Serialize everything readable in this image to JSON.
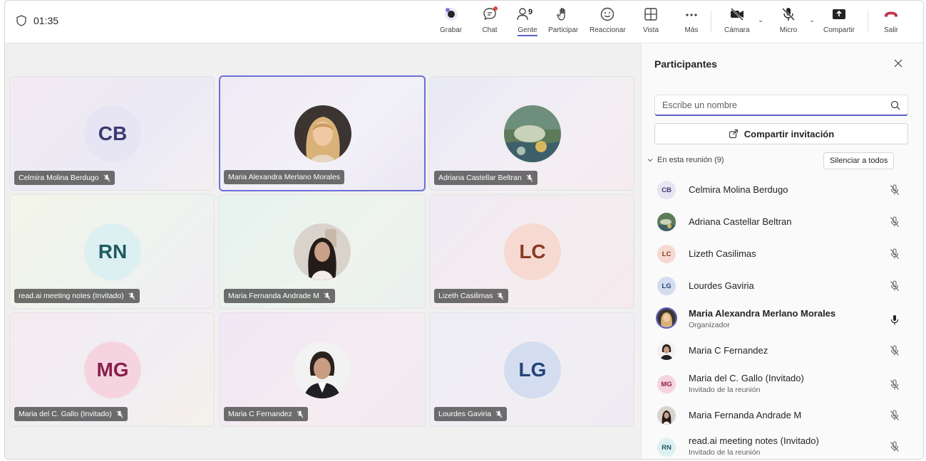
{
  "meeting": {
    "timer": "01:35"
  },
  "toolbar": {
    "record": "Grabar",
    "chat": "Chat",
    "people": "Gente",
    "people_count": "9",
    "raise": "Participar",
    "react": "Reaccionar",
    "view": "Vista",
    "more": "Más",
    "camera": "Cámara",
    "mic": "Micro",
    "share": "Compartir",
    "leave": "Salir",
    "leave_color": "#c4314b",
    "accent": "#5b5fc7"
  },
  "tiles": [
    {
      "name": "Celmira Molina Berdugo",
      "initials": "CB",
      "muted": true
    },
    {
      "name": "Maria Alexandra Merlano Morales",
      "photo": "blonde-woman-avatar",
      "muted": false,
      "speaking": true
    },
    {
      "name": "Adriana Castellar Beltran",
      "photo": "artwork-avatar",
      "muted": true
    },
    {
      "name": "read.ai meeting notes (Invitado)",
      "initials": "RN",
      "muted": true
    },
    {
      "name": "Maria Fernanda Andrade M",
      "photo": "selfie-woman-avatar",
      "muted": true
    },
    {
      "name": "Lizeth Casilimas",
      "initials": "LC",
      "muted": true
    },
    {
      "name": "Maria del C. Gallo (Invitado)",
      "initials": "MG",
      "muted": true
    },
    {
      "name": "Maria C Fernandez",
      "photo": "dark-hair-woman-avatar",
      "muted": true
    },
    {
      "name": "Lourdes Gaviria",
      "initials": "LG",
      "muted": true
    }
  ],
  "panel": {
    "title": "Participantes",
    "search_placeholder": "Escribe un nombre",
    "invite_label": "Compartir invitación",
    "section_label": "En esta reunión (9)",
    "mute_all_label": "Silenciar a todos",
    "participants": [
      {
        "name": "Celmira Molina Berdugo",
        "initials": "CB",
        "subtitle": "",
        "muted": true
      },
      {
        "name": "Adriana Castellar Beltran",
        "initials": "",
        "subtitle": "",
        "muted": true
      },
      {
        "name": "Lizeth Casilimas",
        "initials": "LC",
        "subtitle": "",
        "muted": true
      },
      {
        "name": "Lourdes Gaviria",
        "initials": "LG",
        "subtitle": "",
        "muted": true
      },
      {
        "name": "Maria Alexandra Merlano Morales",
        "initials": "",
        "subtitle": "Organizador",
        "muted": false
      },
      {
        "name": "Maria C Fernandez",
        "initials": "",
        "subtitle": "",
        "muted": true
      },
      {
        "name": "Maria del C. Gallo (Invitado)",
        "initials": "MG",
        "subtitle": "Invitado de la reunión",
        "muted": true
      },
      {
        "name": "Maria Fernanda Andrade M",
        "initials": "",
        "subtitle": "",
        "muted": true
      },
      {
        "name": "read.ai meeting notes (Invitado)",
        "initials": "RN",
        "subtitle": "Invitado de la reunión",
        "muted": true
      }
    ]
  }
}
